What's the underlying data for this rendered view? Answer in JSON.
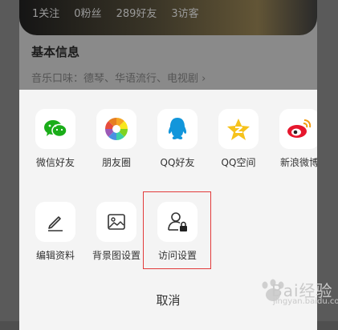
{
  "background": {
    "stats": [
      "1关注",
      "0粉丝",
      "289好友",
      "3访客"
    ],
    "basic_info_title": "基本信息",
    "music_taste": "音乐口味：德琴、华语流行、电视剧 ›"
  },
  "share_row": [
    {
      "label": "微信好友",
      "icon": "wechat-icon"
    },
    {
      "label": "朋友圈",
      "icon": "moments-icon"
    },
    {
      "label": "QQ好友",
      "icon": "qq-icon"
    },
    {
      "label": "QQ空间",
      "icon": "qzone-icon"
    },
    {
      "label": "新浪微博",
      "icon": "weibo-icon"
    }
  ],
  "action_row": [
    {
      "label": "编辑资料",
      "icon": "pencil-icon"
    },
    {
      "label": "背景图设置",
      "icon": "image-icon"
    },
    {
      "label": "访问设置",
      "icon": "user-lock-icon"
    }
  ],
  "cancel_label": "取消",
  "watermark": {
    "text": "Bai经验",
    "url": "jingyan.baidu.com"
  },
  "colors": {
    "wechat": "#1aad19",
    "qq": "#1296db",
    "qzone": "#f6c21c",
    "weibo": "#e6162d",
    "highlight": "#e23b3b"
  }
}
